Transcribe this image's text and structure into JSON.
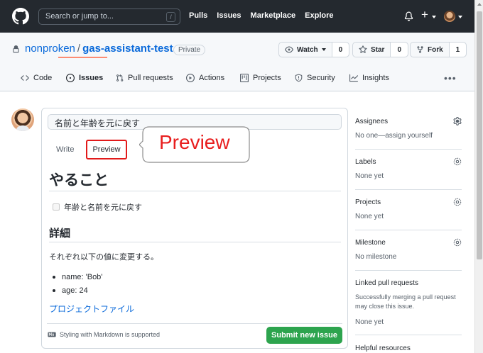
{
  "header": {
    "search_placeholder": "Search or jump to...",
    "search_key": "/",
    "nav": [
      "Pulls",
      "Issues",
      "Marketplace",
      "Explore"
    ],
    "plus": "+"
  },
  "repo": {
    "owner": "nonproken",
    "separator": "/",
    "name": "gas-assistant-test",
    "visibility": "Private",
    "watch": {
      "label": "Watch",
      "count": "0"
    },
    "star": {
      "label": "Star",
      "count": "0"
    },
    "fork": {
      "label": "Fork",
      "count": "1"
    },
    "tabs": [
      "Code",
      "Issues",
      "Pull requests",
      "Actions",
      "Projects",
      "Security",
      "Insights"
    ],
    "active_tab": "Issues",
    "more": "•••"
  },
  "issue": {
    "title_value": "名前と年齢を元に戻す",
    "write_tab": "Write",
    "preview_tab": "Preview",
    "callout": "Preview",
    "preview": {
      "h1": "やること",
      "task": "年齢と名前を元に戻す",
      "h2": "詳細",
      "paragraph": "それぞれ以下の値に変更する。",
      "bullets": [
        "name: 'Bob'",
        "age: 24"
      ],
      "link": "プロジェクトファイル"
    },
    "markdown_note": "Styling with Markdown is supported",
    "submit": "Submit new issue"
  },
  "sidebar": {
    "assignees": {
      "title": "Assignees",
      "value": "No one—assign yourself"
    },
    "labels": {
      "title": "Labels",
      "value": "None yet"
    },
    "projects": {
      "title": "Projects",
      "value": "None yet"
    },
    "milestone": {
      "title": "Milestone",
      "value": "No milestone"
    },
    "linked": {
      "title": "Linked pull requests",
      "desc": "Successfully merging a pull request may close this issue.",
      "value": "None yet"
    },
    "helpful": {
      "title": "Helpful resources"
    }
  },
  "colors": {
    "header_bg": "#24292f",
    "link": "#0969da",
    "submit_green": "#2da44e",
    "annotation_red": "#e21a1a",
    "tab_underline": "#fd8c73"
  }
}
